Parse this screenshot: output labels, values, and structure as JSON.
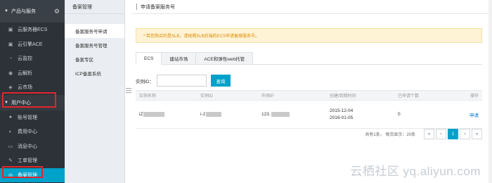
{
  "sidebar": {
    "header": "产品与服务",
    "items_top": [
      {
        "icon": "server-icon",
        "glyph": "▣",
        "label": "云服务器ECS"
      },
      {
        "icon": "engine-icon",
        "glyph": "▣",
        "label": "云引擎ACE"
      },
      {
        "icon": "monitor-icon",
        "glyph": "◔",
        "label": "云监控"
      },
      {
        "icon": "dns-icon",
        "glyph": "◉",
        "label": "云解析"
      },
      {
        "icon": "market-icon",
        "glyph": "◈",
        "label": "云市场"
      }
    ],
    "user_center": "用户中心",
    "items_user": [
      {
        "icon": "user-icon",
        "glyph": "●",
        "label": "账号管理"
      },
      {
        "icon": "wallet-icon",
        "glyph": "◐",
        "label": "费用中心"
      },
      {
        "icon": "message-icon",
        "glyph": "▭",
        "label": "消息中心"
      },
      {
        "icon": "edit-icon",
        "glyph": "✎",
        "label": "工单管理"
      },
      {
        "icon": "filing-icon",
        "glyph": "◎",
        "label": "备案管理"
      }
    ]
  },
  "subnav": {
    "title": "备案管理",
    "items": [
      "备案服务号申请",
      "备案服务号管理",
      "备案专区",
      "ICP备案系统"
    ]
  },
  "main": {
    "title": "申请备案服务号",
    "notice": "* 若您购买的是SLB，请按照SLB后端的ECS申请备案服务号。",
    "tabs": [
      "ECS",
      "建站市场",
      "ACE和弹性web托管"
    ],
    "filter_label": "实例ID：",
    "query_button": "查询",
    "columns": [
      "实例名称",
      "实例ID",
      "外网IP",
      "创建/到期时间",
      "已申请个数",
      "操作"
    ],
    "rows": [
      {
        "name": "iZ",
        "id": "i-2",
        "ip": "123.",
        "created": "2015-12-04",
        "expires": "2016-01-05",
        "count": "0",
        "action": "申请"
      }
    ],
    "pager_info": "共有1条， 每页显示：20条",
    "pager": [
      "«",
      "‹",
      "1",
      "›",
      "»"
    ]
  },
  "watermark": "云栖社区 yq.aliyun.com"
}
